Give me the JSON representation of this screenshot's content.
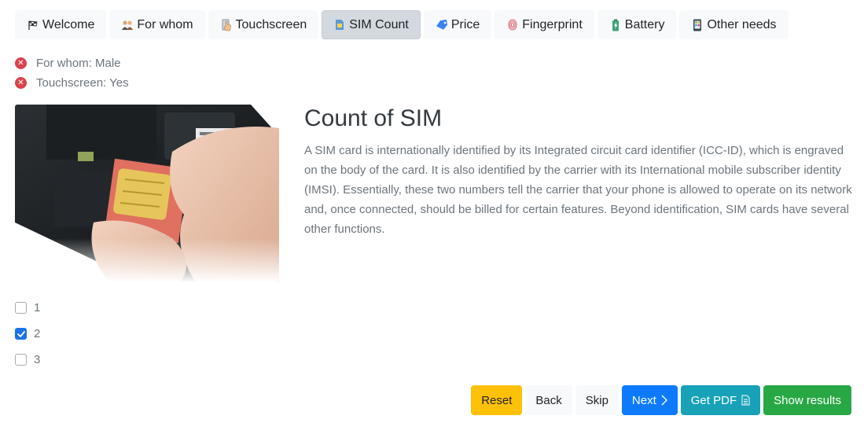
{
  "tabs": [
    {
      "label": "Welcome",
      "icon": "checkered-flag-icon",
      "active": false
    },
    {
      "label": "For whom",
      "icon": "people-icon",
      "active": false
    },
    {
      "label": "Touchscreen",
      "icon": "touch-hand-icon",
      "active": false
    },
    {
      "label": "SIM Count",
      "icon": "sim-card-icon",
      "active": true
    },
    {
      "label": "Price",
      "icon": "price-tag-icon",
      "active": false
    },
    {
      "label": "Fingerprint",
      "icon": "fingerprint-icon",
      "active": false
    },
    {
      "label": "Battery",
      "icon": "battery-icon",
      "active": false
    },
    {
      "label": "Other needs",
      "icon": "phone-icon",
      "active": false
    }
  ],
  "summary": [
    {
      "text": "For whom: Male"
    },
    {
      "text": "Touchscreen: Yes"
    }
  ],
  "question": {
    "title": "Count of SIM",
    "description": "A SIM card is internationally identified by its Integrated circuit card identifier (ICC-ID), which is engraved on the body of the card. It is also identified by the carrier with its International mobile subscriber identity (IMSI). Essentially, these two numbers tell the carrier that your phone is allowed to operate on its network and, once connected, should be billed for certain features. Beyond identification, SIM cards have several other functions."
  },
  "options": [
    {
      "label": "1",
      "checked": false
    },
    {
      "label": "2",
      "checked": true
    },
    {
      "label": "3",
      "checked": false
    }
  ],
  "actions": {
    "reset": "Reset",
    "back": "Back",
    "skip": "Skip",
    "next": "Next",
    "pdf": "Get PDF",
    "results": "Show results"
  },
  "colors": {
    "reset": "#ffc107",
    "next": "#0d7aff",
    "pdf": "#17a2b8",
    "results": "#28a745",
    "remove": "#d9434f",
    "checked": "#1a73e8"
  }
}
